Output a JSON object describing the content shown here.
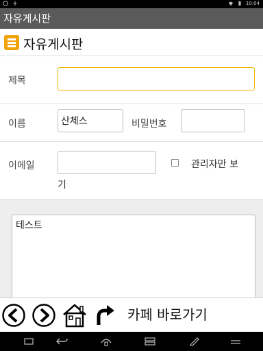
{
  "status_bar": {
    "time": "10:04"
  },
  "app": {
    "title": "자유게시판"
  },
  "header": {
    "title": "자유게시판",
    "menu_icon": "hamburger-menu-icon",
    "accent_color": "#f0a30a"
  },
  "form": {
    "subject": {
      "label": "제목",
      "value": ""
    },
    "name": {
      "label": "이름",
      "value": "산체스"
    },
    "password": {
      "label": "비밀번호",
      "value": ""
    },
    "email": {
      "label": "이메일",
      "value": ""
    },
    "admin_only": {
      "label_line1": "관리자만 보",
      "label_line2": "기",
      "checked": false
    }
  },
  "content": {
    "value": "테스트"
  },
  "toolbar": {
    "back_icon": "back-arrow-icon",
    "forward_icon": "forward-arrow-icon",
    "home_icon": "home-icon",
    "refresh_icon": "redo-arrow-icon",
    "cafe_link": "카페 바로가기"
  }
}
